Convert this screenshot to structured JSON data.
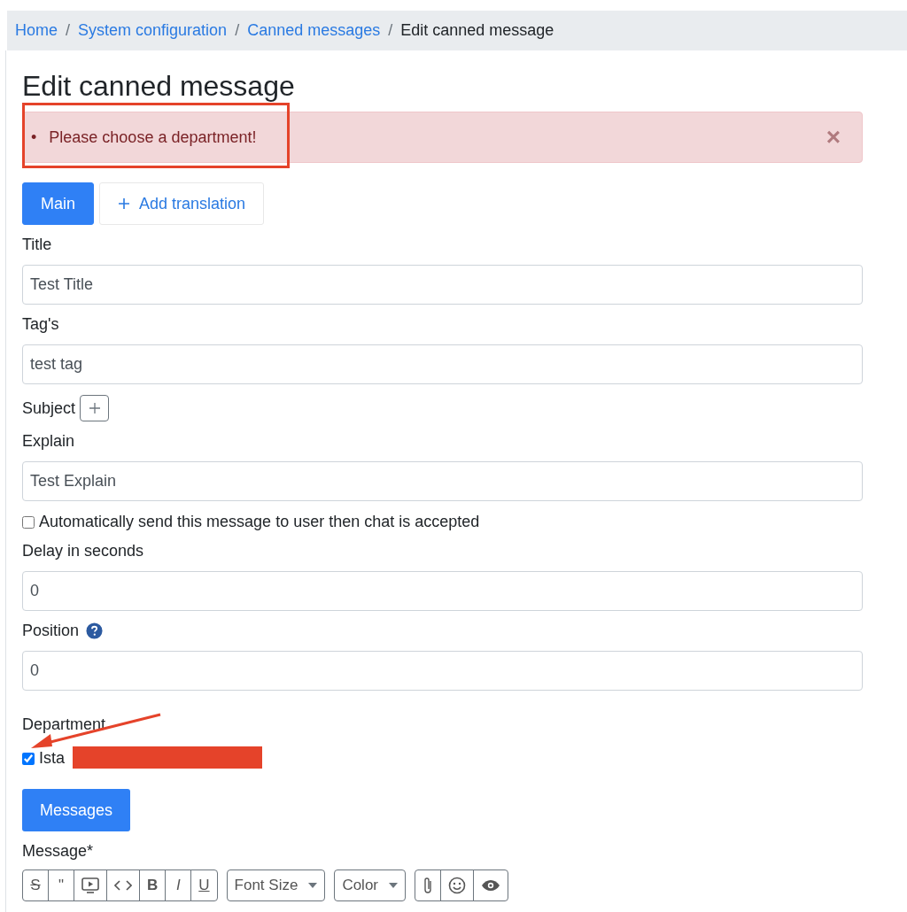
{
  "breadcrumb": [
    {
      "label": "Home",
      "kind": "link"
    },
    {
      "label": "System configuration",
      "kind": "link"
    },
    {
      "label": "Canned messages",
      "kind": "link"
    },
    {
      "label": "Edit canned message",
      "kind": "current"
    }
  ],
  "breadcrumb_separator": "/",
  "heading": "Edit canned message",
  "alert": {
    "bullet": "•",
    "items": [
      "Please choose a department!"
    ],
    "close": "×"
  },
  "tabs": [
    {
      "label": "Main",
      "selected": true,
      "icon": false
    },
    {
      "label": "Add translation",
      "selected": false,
      "icon": true
    }
  ],
  "form": [
    {
      "kind": "input",
      "label": "Title",
      "value": "Test Title"
    },
    {
      "kind": "input",
      "label": "Tag's",
      "value": "test tag"
    },
    {
      "kind": "add",
      "label": "Subject"
    },
    {
      "kind": "input",
      "label": "Explain",
      "value": "Test Explain"
    },
    {
      "kind": "checkbox",
      "label": "Automatically send this message to user then chat is accepted",
      "checked": false
    },
    {
      "kind": "input",
      "label": "Delay in seconds",
      "value": "0"
    },
    {
      "kind": "input",
      "label": "Position",
      "value": "0",
      "help": true
    },
    {
      "kind": "heading",
      "label": "Department"
    },
    {
      "kind": "checkbox",
      "label": "Ista",
      "checked": true,
      "redacted": true
    }
  ],
  "messages_button": "Messages",
  "message_label": "Message*",
  "toolbar": [
    [
      {
        "kind": "strike",
        "label": "S"
      },
      {
        "kind": "quote",
        "label": "\""
      },
      {
        "kind": "video"
      },
      {
        "kind": "code"
      },
      {
        "kind": "bold",
        "label": "B"
      },
      {
        "kind": "italic",
        "label": "I"
      },
      {
        "kind": "underline",
        "label": "U"
      }
    ],
    [
      {
        "kind": "dropdown",
        "label": "Font Size"
      }
    ],
    [
      {
        "kind": "dropdown",
        "label": "Color"
      }
    ],
    [
      {
        "kind": "attach"
      },
      {
        "kind": "emoji"
      },
      {
        "kind": "preview"
      }
    ]
  ]
}
